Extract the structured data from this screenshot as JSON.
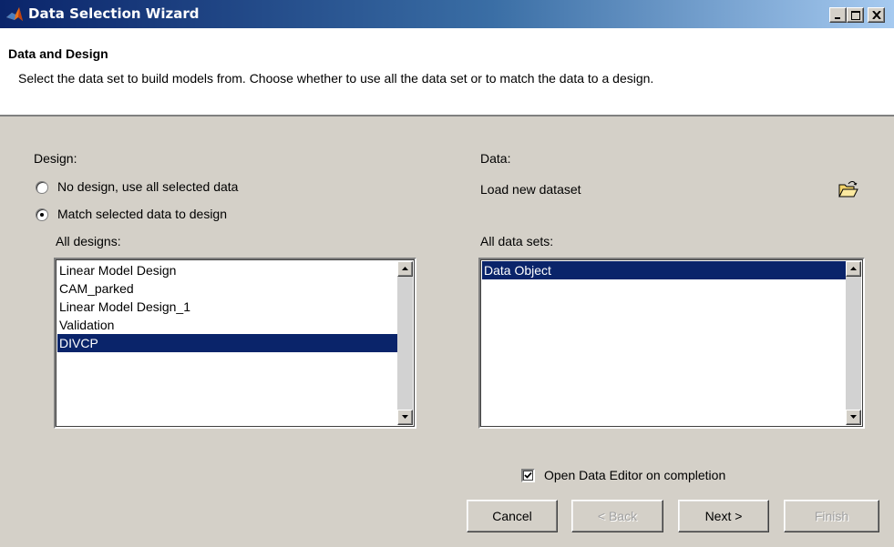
{
  "window": {
    "title": "Data Selection Wizard",
    "app_icon": "matlab-logo-icon",
    "controls": [
      "minimize-icon",
      "maximize-icon",
      "close-icon"
    ]
  },
  "header": {
    "title": "Data and Design",
    "description": "Select the data set to build models from. Choose whether to use all the data set or to match the data to a design."
  },
  "design": {
    "label": "Design:",
    "options": [
      {
        "label": "No design, use all selected data",
        "selected": false
      },
      {
        "label": "Match selected data to design",
        "selected": true
      }
    ],
    "list_label": "All designs:",
    "items": [
      "Linear Model Design",
      "CAM_parked",
      "Linear Model Design_1",
      "Validation",
      "DIVCP"
    ],
    "selected_item": "DIVCP"
  },
  "data": {
    "label": "Data:",
    "load_label": "Load new dataset",
    "load_icon": "open-folder-icon",
    "list_label": "All data sets:",
    "items": [
      "Data Object"
    ],
    "selected_item": "Data Object"
  },
  "options": {
    "open_editor_label": "Open Data Editor on completion",
    "open_editor_checked": true
  },
  "buttons": {
    "cancel": "Cancel",
    "back": "< Back",
    "next": "Next >",
    "finish": "Finish"
  },
  "colors": {
    "title_bar": "#0a246a",
    "selection": "#0a246a",
    "dialog_bg": "#d4d0c8"
  }
}
